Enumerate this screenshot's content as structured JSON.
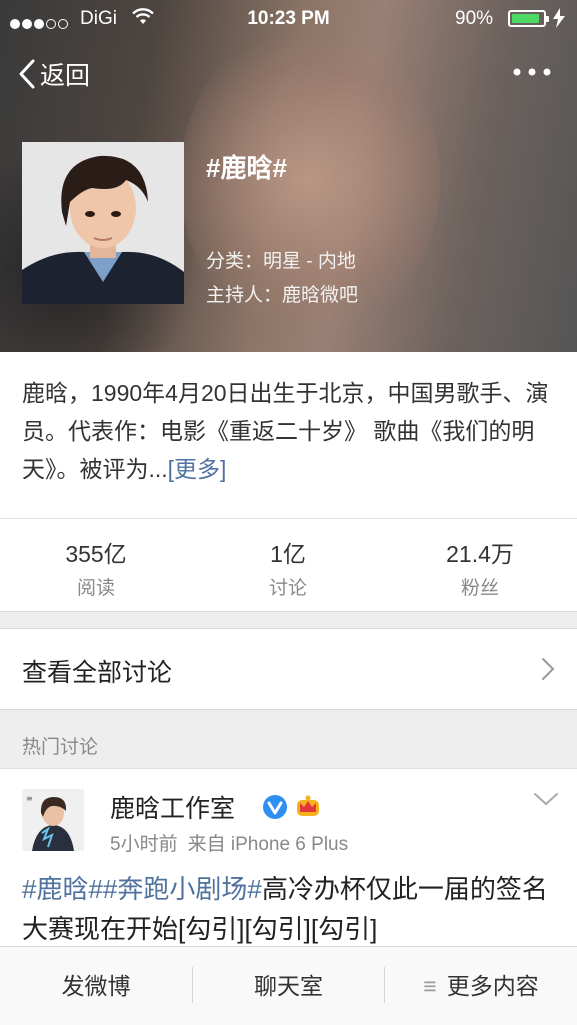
{
  "status_bar": {
    "carrier": "DiGi",
    "time": "10:23 PM",
    "battery_percent": "90%",
    "battery_level": 0.9,
    "signal_bars_filled": 3,
    "signal_bars_total": 5
  },
  "nav": {
    "back_label": "返回"
  },
  "topic": {
    "title": "#鹿晗#",
    "category": "分类：明星 - 内地",
    "host": "主持人：鹿晗微吧",
    "description": "鹿晗，1990年4月20日出生于北京，中国男歌手、演员。代表作：电影《重返二十岁》 歌曲《我们的明天》。被评为...",
    "more_label": "[更多]"
  },
  "stats": [
    {
      "value": "355亿",
      "label": "阅读"
    },
    {
      "value": "1亿",
      "label": "讨论"
    },
    {
      "value": "21.4万",
      "label": "粉丝"
    }
  ],
  "view_all": {
    "label": "查看全部讨论"
  },
  "hot_section": {
    "title": "热门讨论"
  },
  "post": {
    "author": "鹿晗工作室",
    "time": "5小时前",
    "source": "来自 iPhone 6 Plus",
    "tags": [
      "#鹿晗#",
      "#奔跑小剧场#"
    ],
    "text": "高冷办杯仅此一届的签名大赛现在开始[勾引][勾引][勾引]"
  },
  "bottom_bar": {
    "post_label": "发微博",
    "chat_label": "聊天室",
    "more_label": "更多内容",
    "more_icon": "≡"
  },
  "colors": {
    "link": "#50729f",
    "battery": "#4cd964",
    "verified": "#2f8ff0",
    "crown": "#f5b21e"
  },
  "icons": [
    "chevron-left-icon",
    "more-dots-icon",
    "chevron-right-icon",
    "verified-icon",
    "crown-icon",
    "chevron-down-icon",
    "wifi-icon",
    "charging-icon",
    "menu-icon"
  ]
}
